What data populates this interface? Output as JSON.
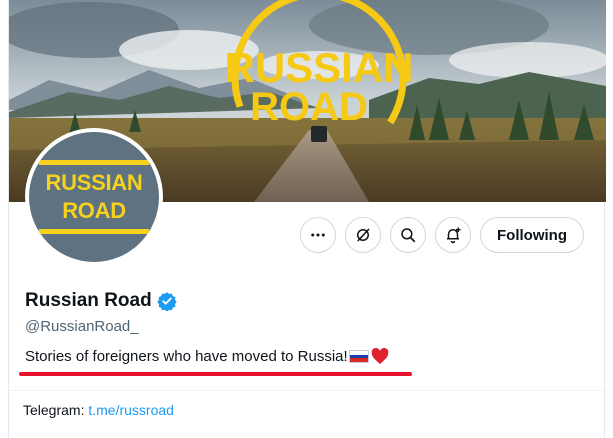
{
  "banner": {
    "logo_text_line1": "RUSSIAN",
    "logo_text_line2": "ROAD",
    "accent_color": "#f6c915"
  },
  "avatar": {
    "line1": "RUSSIAN",
    "line2": "ROAD",
    "bg_color": "#5e7281",
    "text_color": "#f6d21c"
  },
  "actions": {
    "more_icon": "more-icon",
    "grok_icon": "grok-icon",
    "search_icon": "search-icon",
    "notify_icon": "bell-plus-icon",
    "follow_label": "Following"
  },
  "profile": {
    "display_name": "Russian Road",
    "verified": true,
    "handle": "@RussianRoad_",
    "bio": "Stories of foreigners who have moved to Russia!",
    "bio_emojis": [
      "russian-flag",
      "red-heart"
    ],
    "telegram_label": "Telegram:",
    "telegram_link": "t.me/russroad"
  },
  "colors": {
    "link": "#1d9bf0",
    "verified": "#1d9bf0",
    "annotation_underline": "#e8112d"
  }
}
